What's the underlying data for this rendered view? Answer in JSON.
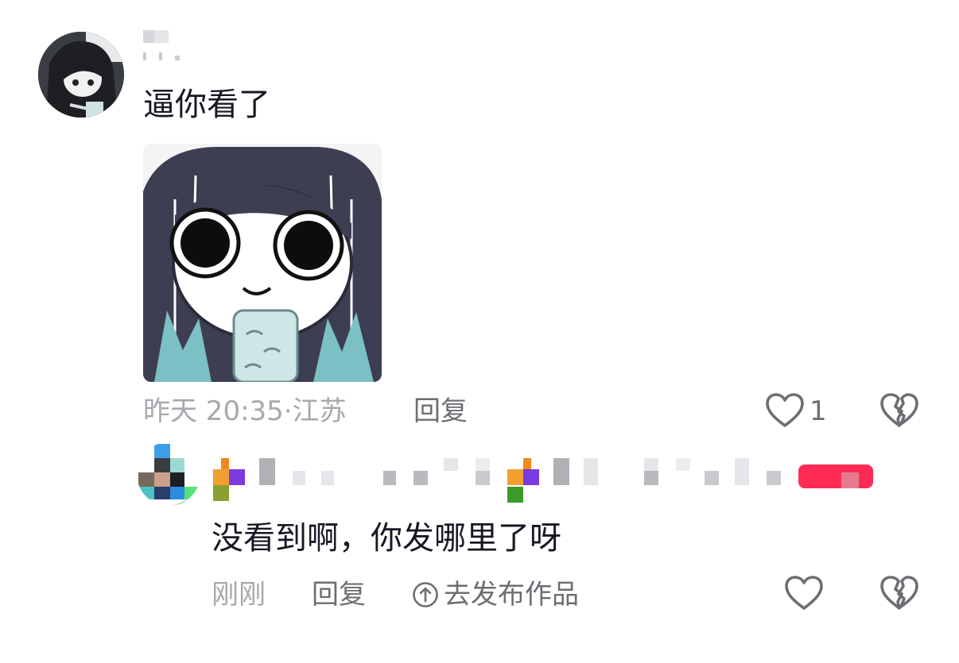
{
  "main_comment": {
    "text": "逼你看了",
    "timestamp": "昨天 20:35",
    "location_sep": "·",
    "location": "江苏",
    "reply_label": "回复",
    "like_count": "1",
    "like_icon": "heart-outline-icon",
    "dislike_icon": "broken-heart-icon"
  },
  "reply_comment": {
    "text": "没看到啊，你发哪里了呀",
    "timestamp": "刚刚",
    "reply_label": "回复",
    "publish_label": "去发布作品",
    "publish_icon": "arrow-up-circle-icon",
    "like_icon": "heart-outline-icon",
    "dislike_icon": "broken-heart-icon"
  },
  "colors": {
    "text_primary": "#161823",
    "text_secondary": "#a7a8ad",
    "text_action": "#6d6e73",
    "author_badge": "#fe2c55"
  }
}
